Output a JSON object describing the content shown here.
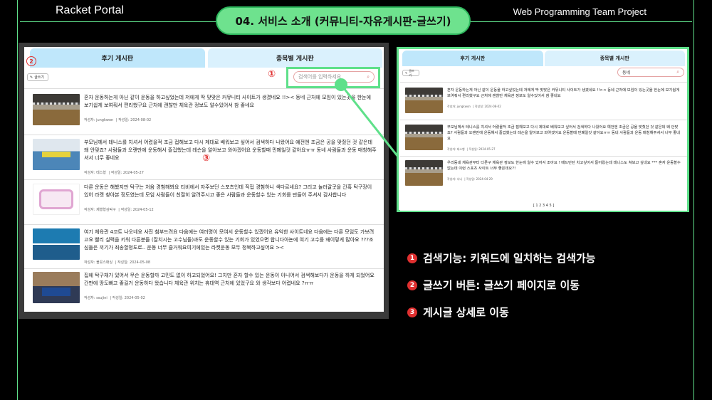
{
  "header": {
    "brand": "Racket Portal",
    "section_title": "04. 서비스 소개 (커뮤니티-자유게시판-글쓰기)",
    "project": "Web Programming Team Project"
  },
  "board": {
    "tabs": [
      "후기 게시판",
      "종목별 게시판"
    ],
    "write_label": "글쓰기",
    "search_placeholder": "검색어를 입력하세요",
    "posts": [
      {
        "text": "혼자 운동하는게 아닌 같이 운동을 하고싶었는데 저에게 딱 맞맞은 커뮤니티 사이트가 생겼네요 !!>< 동네 근처에 모임이 있는곳을 한눈에 보기쉽게 보여줘서 편리했구요 근처에 괜찮만 체육관 정보도 알수있어서 참 좋네요",
        "author": "작성자: jungkwon",
        "date": "작성일: 2024-08-02"
      },
      {
        "text": "부모님께서 테니스를 치셔서 어렸을적 조금 접해보고 다시 제대로 배워보고 싶어서 검색하다 나왔어요 예전엔 조금은 공을 맞췄던 것 같은데 왜 안맞죠? 사람들과 오랜만에 운동해서 즐겁했는데 레슨을 알아보고 와야겠어요 운동할때 민폐일것 같아요ㅠㅠ 동네 사람들과 운동 매칭해주셔서 너무 좋네요",
        "author": "작성자: 테스형",
        "date": "작성일: 2024-05-27"
      },
      {
        "text": "다른 운동은 해봤지만 탁구는 처음 경험해봐요 티비에서 자주보던 스포츠인데 직접 경험하니 색다르네요? 그리고 놀러갈곳을 간혹 탁구장이 있어 라켓 찾아본 정도였는데 모임 사람들이 친절히 알려주시고 좋은 사람들과 운동할수 있는 기회를 만들어 주셔서 감사합니다",
        "author": "작성자: 제행형김탁구",
        "date": "작성일: 2024-05-12"
      },
      {
        "text": "여기 체육관 4코트 나오네요 사진 첨부드려요 다음에는 여러명이 모여서 운동할수 있겠어요 유익한 사이트네요 다음에는 다른 모임도 가보려고요 빨리 실력을 키워 다른분들 (잘치시는 고수님들)과도 운동할수 있는 기회가 있었으면 합니다아뇬에 여기 고수를 왜이렇게 많아요 ???조심들은 끼기가 죄송할정도로.. 운동 너무 즐거워요여기에있는 라켓운동 모두 정복하고싶어요 ><",
        "author": "작성자: 볼꼿스매싱",
        "date": "작성일: 2024-05-08"
      },
      {
        "text": "집에 탁구채가 있어서 무슨 운동할까 고민도 없이 하고되었어요! 그치만 혼자 할수 있는 운동이 아니어서 검색해보다가 운동을 하게 되었어요 간판에 땅도빠고 좋길거 운동하다 왔습니다 체육관 위치는 휴대역 근처에 있었구요 와 생각보다 어렵네요 ?ㅠㅠ",
        "author": "작성자: ssujini",
        "date": "작성일: 2024-05-02"
      }
    ]
  },
  "search_demo": {
    "tabs": [
      "후기 게시판",
      "종목별 게시판"
    ],
    "write_label": "글쓰기",
    "search_value": "동네",
    "posts": [
      {
        "text": "혼자 운동하는게 아닌 같이 운동을 하고싶었는데 저에게 딱 맞맞은 커뮤니티 사이트가 생겼네요 !!>< 동네 근처에 모임이 있는곳을 한눈에 보기쉽게 보여줘서 편리했구요 근처에 괜찮만 체육관 정보도 알수있어서 참 좋네요",
        "author": "작성자: jungkwon",
        "date": "작성일: 2024-08-02"
      },
      {
        "text": "부모님께서 테니스를 치셔서 어렸을적 조금 접해보고 다시 제대로 배워보고 싶어서 검색하다 나왔어요 예전엔 조금은 공을 맞췄던 것 같은데 왜 안맞죠? 사람들과 오랜만에 운동해서 즐겁했는데 레슨을 알아보고 와야겠어요 운동할때 민폐일것 같아요ㅠㅠ 동네 사람들과 운동 매칭해주셔서 너무 좋네요",
        "author": "작성자: 테스형",
        "date": "작성일: 2024-05-27"
      },
      {
        "text": "우리동네 체육관부터 다른구 체육관 정보도 한눈에 알수 있어서 조아요 ! 배드민턴 치고싶어서 들어왔는데 테니스도 쳐보고 싶네요 *** 혼자 운동할수 없는데 이런 스포츠 사이트 너무 좋은데요?!",
        "author": "작성자: 서니",
        "date": "작성일: 2024-04-29"
      }
    ],
    "pagination": "[ 1 2 3 4 5 ]"
  },
  "markers": [
    "①",
    "②",
    "③"
  ],
  "features": [
    {
      "num": "1",
      "text": "검색기능: 키워드에 일치하는 검색가능"
    },
    {
      "num": "2",
      "text": "글쓰기 버튼: 글쓰기 페이지로 이동"
    },
    {
      "num": "3",
      "text": "게시글 상세로 이동"
    }
  ],
  "colors": {
    "accent": "#5fe08a",
    "marker": "#e03030",
    "tab": "#bfe7fb"
  },
  "icons": {
    "write": "pencil-icon",
    "search": "search-icon"
  }
}
